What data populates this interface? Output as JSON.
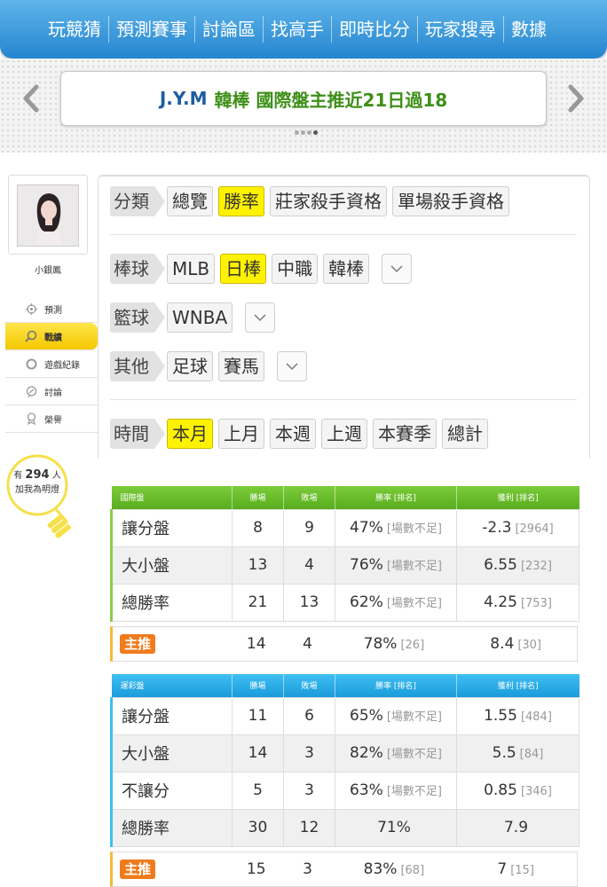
{
  "nav": {
    "items": [
      "玩競猜",
      "預測賽事",
      "討論區",
      "找高手",
      "即時比分",
      "玩家搜尋",
      "數據"
    ]
  },
  "banner": {
    "name": "J.Y.M",
    "text": "韓棒 國際盤主推近21日過18"
  },
  "user": {
    "name": "小銀鳳"
  },
  "sidebar": {
    "items": [
      {
        "label": "預測",
        "icon": "target-icon"
      },
      {
        "label": "戰績",
        "icon": "magnifier-icon"
      },
      {
        "label": "遊戲紀錄",
        "icon": "circle-icon"
      },
      {
        "label": "討論",
        "icon": "chat-icon"
      },
      {
        "label": "榮譽",
        "icon": "medal-icon"
      }
    ],
    "active_index": 1
  },
  "fans": {
    "prefix": "有",
    "count": "294",
    "suffix": "人",
    "line2": "加我為明燈"
  },
  "filters": {
    "category": {
      "label": "分類",
      "options": [
        "總覽",
        "勝率",
        "莊家殺手資格",
        "單場殺手資格"
      ],
      "selected": "勝率"
    },
    "baseball": {
      "label": "棒球",
      "options": [
        "MLB",
        "日棒",
        "中職",
        "韓棒"
      ],
      "selected": "日棒"
    },
    "basketball": {
      "label": "籃球",
      "options": [
        "WNBA"
      ]
    },
    "other": {
      "label": "其他",
      "options": [
        "足球",
        "賽馬"
      ]
    },
    "time": {
      "label": "時間",
      "options": [
        "本月",
        "上月",
        "本週",
        "上週",
        "本賽季",
        "總計"
      ],
      "selected": "本月"
    }
  },
  "table_intl": {
    "headers": [
      "國際盤",
      "勝場",
      "敗場",
      "勝率 [排名]",
      "獲利 [排名]"
    ],
    "rows": [
      {
        "name": "讓分盤",
        "win": "8",
        "lose": "9",
        "rate": "47%",
        "rate_rank": "[場數不足]",
        "profit": "-2.3",
        "profit_rank": "[2964]"
      },
      {
        "name": "大小盤",
        "win": "13",
        "lose": "4",
        "rate": "76%",
        "rate_rank": "[場數不足]",
        "profit": "6.55",
        "profit_rank": "[232]"
      },
      {
        "name": "總勝率",
        "win": "21",
        "lose": "13",
        "rate": "62%",
        "rate_rank": "[場數不足]",
        "profit": "4.25",
        "profit_rank": "[753]"
      }
    ],
    "main": {
      "tag": "主推",
      "win": "14",
      "lose": "4",
      "rate": "78%",
      "rate_rank": "[26]",
      "profit": "8.4",
      "profit_rank": "[30]"
    }
  },
  "table_lottery": {
    "headers": [
      "運彩盤",
      "勝場",
      "敗場",
      "勝率 [排名]",
      "獲利 [排名]"
    ],
    "rows": [
      {
        "name": "讓分盤",
        "win": "11",
        "lose": "6",
        "rate": "65%",
        "rate_rank": "[場數不足]",
        "profit": "1.55",
        "profit_rank": "[484]"
      },
      {
        "name": "大小盤",
        "win": "14",
        "lose": "3",
        "rate": "82%",
        "rate_rank": "[場數不足]",
        "profit": "5.5",
        "profit_rank": "[84]"
      },
      {
        "name": "不讓分",
        "win": "5",
        "lose": "3",
        "rate": "63%",
        "rate_rank": "[場數不足]",
        "profit": "0.85",
        "profit_rank": "[346]"
      },
      {
        "name": "總勝率",
        "win": "30",
        "lose": "12",
        "rate": "71%",
        "rate_rank": "",
        "profit": "7.9",
        "profit_rank": ""
      }
    ],
    "main": {
      "tag": "主推",
      "win": "15",
      "lose": "3",
      "rate": "83%",
      "rate_rank": "[68]",
      "profit": "7",
      "profit_rank": "[15]"
    }
  }
}
